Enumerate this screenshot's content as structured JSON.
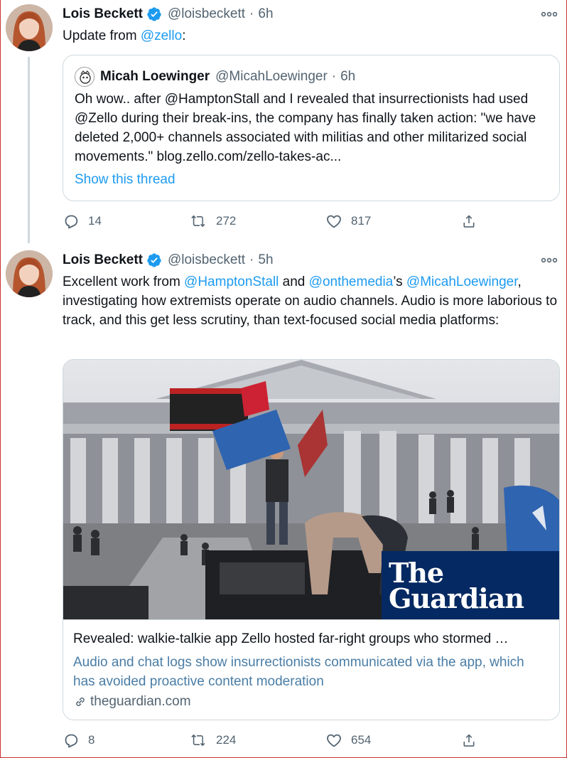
{
  "tweets": [
    {
      "author": {
        "name": "Lois Beckett",
        "handle": "@loisbeckett",
        "time": "6h"
      },
      "text_parts": [
        "Update from ",
        "@zello",
        ":"
      ],
      "quote": {
        "author": {
          "name": "Micah Loewinger",
          "handle": "@MicahLoewinger",
          "time": "6h"
        },
        "text": "Oh wow.. after @HamptonStall and I revealed that insurrectionists had used @Zello during their break-ins, the company has finally taken action: \"we have deleted 2,000+ channels associated with militias and other militarized social movements.\" blog.zello.com/zello-takes-ac...",
        "show_thread": "Show this thread"
      },
      "stats": {
        "replies": "14",
        "retweets": "272",
        "likes": "817"
      }
    },
    {
      "author": {
        "name": "Lois Beckett",
        "handle": "@loisbeckett",
        "time": "5h"
      },
      "text_parts": [
        "Excellent work from ",
        "@HamptonStall",
        " and ",
        "@onthemedia",
        "’s ",
        "@MicahLoewinger",
        ", investigating how extremists operate on audio channels. Audio is more laborious to track, and this get less scrutiny, than text-focused social media platforms:"
      ],
      "card": {
        "title": "Revealed: walkie-talkie app Zello hosted far-right groups who stormed …",
        "description": "Audio and chat logs show insurrectionists communicated via the app, which has avoided proactive content moderation",
        "domain": "theguardian.com",
        "brand_line1": "The",
        "brand_line2": "Guardian"
      },
      "stats": {
        "replies": "8",
        "retweets": "224",
        "likes": "654"
      }
    }
  ],
  "colors": {
    "accent": "#1d9bf0",
    "muted": "#536471",
    "guardian_blue": "#052962"
  }
}
